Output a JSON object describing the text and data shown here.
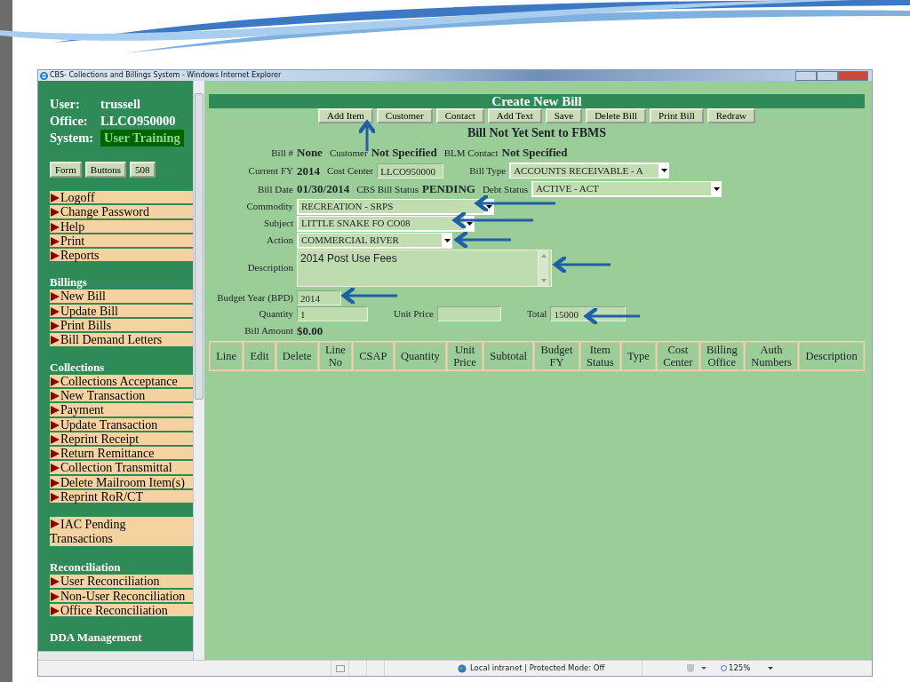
{
  "window": {
    "title": "CBS- Collections and Billings System - Windows Internet Explorer"
  },
  "sidebar": {
    "user_label": "User:",
    "user": "trussell",
    "office_label": "Office:",
    "office": "LLCO950000",
    "system_label": "System:",
    "system": "User Training",
    "buttons": [
      "Form",
      "Buttons",
      "508"
    ],
    "sections": [
      {
        "items": [
          "Logoff",
          "Change Password",
          "Help",
          "Print",
          "Reports"
        ]
      },
      {
        "heading": "Billings",
        "items": [
          "New Bill",
          "Update Bill",
          "Print Bills",
          "Bill Demand Letters"
        ]
      },
      {
        "heading": "Collections",
        "items": [
          "Collections Acceptance",
          "New Transaction",
          "Payment",
          "Update Transaction",
          "Reprint Receipt",
          "Return Remittance",
          "Collection Transmittal",
          "Delete Mailroom Item(s)",
          "Reprint RoR/CT"
        ]
      },
      {
        "items": [
          "IAC Pending Transactions"
        ]
      },
      {
        "heading": "Reconciliation",
        "items": [
          "User Reconciliation",
          "Non-User Reconciliation",
          "Office Reconciliation"
        ]
      },
      {
        "heading": "DDA Management"
      }
    ]
  },
  "main": {
    "title": "Create New Bill",
    "buttons": [
      "Add Item",
      "Customer",
      "Contact",
      "Add Text",
      "Save",
      "Delete Bill",
      "Print Bill",
      "Redraw"
    ],
    "status": "Bill Not Yet Sent to FBMS",
    "fields": [
      [
        {
          "label": "Bill #",
          "value": "None",
          "kind": "text"
        },
        {
          "label": "Customer",
          "value": "Not Specified",
          "kind": "text"
        },
        {
          "label": "BLM Contact",
          "value": "Not Specified",
          "kind": "text"
        }
      ],
      [
        {
          "label": "Current FY",
          "value": "2014",
          "kind": "text"
        },
        {
          "label": "Cost Center",
          "value": "LLCO950000",
          "kind": "input"
        },
        {
          "label": "Bill Type",
          "value": "ACCOUNTS RECEIVABLE - A",
          "kind": "select"
        }
      ],
      [
        {
          "label": "Bill Date",
          "value": "01/30/2014",
          "kind": "text"
        },
        {
          "label": "CBS Bill Status",
          "value": "PENDING",
          "kind": "text"
        },
        {
          "label": "Debt Status",
          "value": "ACTIVE - ACT",
          "kind": "select"
        }
      ],
      [
        {
          "label": "Commodity",
          "value": "RECREATION - SRPS",
          "kind": "select"
        }
      ],
      [
        {
          "label": "Subject",
          "value": "LITTLE SNAKE FO CO08",
          "kind": "select"
        }
      ],
      [
        {
          "label": "Action",
          "value": "COMMERCIAL RIVER",
          "kind": "select"
        }
      ],
      [
        {
          "label": "Description",
          "value": "2014 Post Use Fees",
          "kind": "textarea"
        }
      ],
      [
        {
          "label": "Budget Year (BPD)",
          "value": "2014",
          "kind": "input"
        }
      ],
      [
        {
          "label": "Quantity",
          "value": "1",
          "kind": "input"
        },
        {
          "label": "Unit Price",
          "kind": "input"
        },
        {
          "label": "Total",
          "value": "15000",
          "kind": "input"
        }
      ],
      [
        {
          "label": "Bill Amount",
          "value": "$0.00",
          "kind": "text"
        }
      ]
    ],
    "table": {
      "columns": [
        "Line",
        "Edit",
        "Delete",
        "Line No",
        "CSAP",
        "Quantity",
        "Unit Price",
        "Subtotal",
        "Budget FY",
        "Item Status",
        "Type",
        "Cost Center",
        "Billing Office",
        "Auth Numbers",
        "Description"
      ]
    }
  },
  "status_bar": {
    "zone": "Local intranet | Protected Mode: Off",
    "zoom": "125%"
  }
}
